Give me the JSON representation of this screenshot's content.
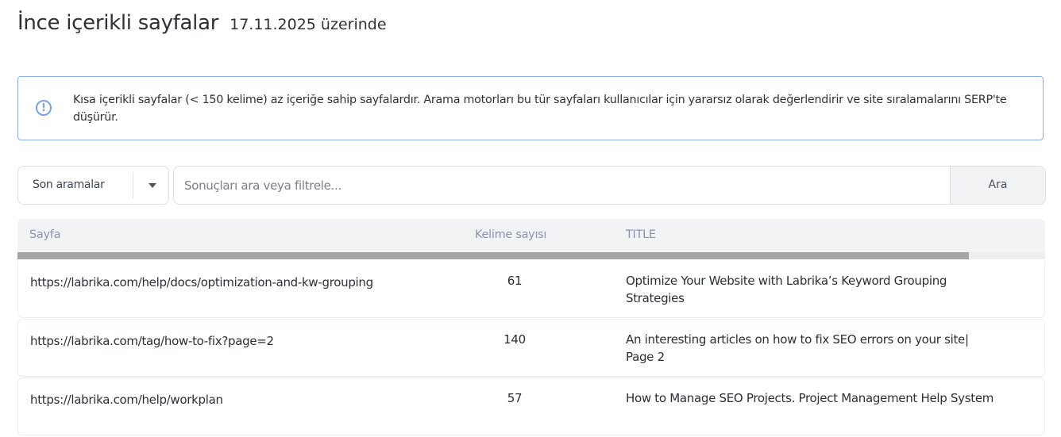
{
  "header": {
    "title": "İnce içerikli sayfalar",
    "date": "17.11.2025 üzerinde"
  },
  "info": {
    "icon": "exclamation-circle-icon",
    "text": "Kısa içerikli sayfalar (< 150 kelime) az içeriğe sahip sayfalardır. Arama motorları bu tür sayfaları kullanıcılar için yararsız olarak değerlendirir ve site sıralamalarını SERP'te düşürür."
  },
  "filter": {
    "recent_label": "Son aramalar",
    "search_placeholder": "Sonuçları ara veya filtrele...",
    "search_value": "",
    "search_button": "Ara"
  },
  "table": {
    "columns": [
      "Sayfa",
      "Kelime sayısı",
      "TITLE"
    ],
    "rows": [
      {
        "url": "https://labrika.com/help/docs/optimization-and-kw-grouping",
        "count": "61",
        "title": "Optimize Your Website with Labrika’s Keyword Grouping Strategies"
      },
      {
        "url": "https://labrika.com/tag/how-to-fix?page=2",
        "count": "140",
        "title": "An interesting articles on how to fix SEO errors on your site| Page 2"
      },
      {
        "url": "https://labrika.com/help/workplan",
        "count": "57",
        "title": "How to Manage SEO Projects. Project Management Help System"
      }
    ]
  },
  "colors": {
    "accent": "#7d9fe3",
    "header_bg": "#f2f3f5"
  }
}
